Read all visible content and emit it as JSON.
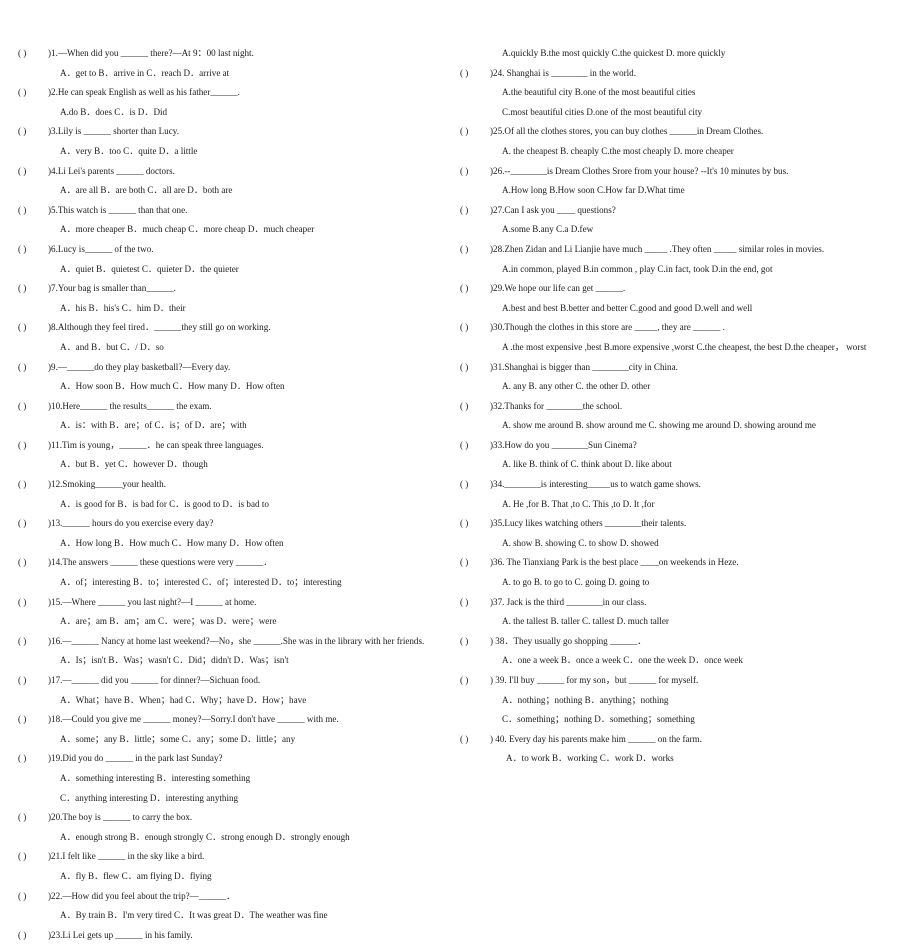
{
  "document": {
    "type": "english-grammar-multiple-choice-worksheet",
    "paren_marker": "(          )"
  },
  "left_column": [
    {
      "paren": "(",
      "stem": ")1.—When did you ______ there?—At 9：00 last night.",
      "options": [
        "A．get to                     B．arrive in      C．reach          D．arrive at"
      ]
    },
    {
      "paren": "(",
      "stem": ")2.He can speak English as well as his father______.",
      "options": [
        "A.do                          B．does            C．is                      D．Did"
      ]
    },
    {
      "paren": "(",
      "stem": ")3.Lily is ______ shorter than Lucy.",
      "options": [
        "A．very                      B．too              C．quite            D．a little"
      ]
    },
    {
      "paren": "(",
      "stem": ")4.Li Lei's parents ______ doctors.",
      "options": [
        "A．are all        B．are both        C．all are            D．both are"
      ]
    },
    {
      "paren": "(",
      "stem": ")5.This watch is ______ than that one.",
      "options": [
        "A．more cheaper        B．much cheap    C．more cheap        D．much cheaper"
      ]
    },
    {
      "paren": "(",
      "stem": ")6.Lucy is______ of the two.",
      "options": [
        "A．quiet            B．quietest      C．quieter        D．the quieter"
      ]
    },
    {
      "paren": "(",
      "stem": ")7.Your bag is smaller than______.",
      "options": [
        "A．his              B．his's      C．him      D．their"
      ]
    },
    {
      "paren": "(",
      "stem": ")8.Although they feel tired．______they still go on working.",
      "options": [
        "A．and            B．but          C．/        D．so"
      ]
    },
    {
      "paren": "(",
      "stem": ")9.—______do they play basketball?—Every day.",
      "options": [
        "A．How soon      B．How much    C．How many        D．How often"
      ]
    },
    {
      "paren": "(",
      "stem": ")10.Here______ the results______ the exam.",
      "options": [
        "A．is：with            B．are；of    C．is；of          D．are；with"
      ]
    },
    {
      "paren": "(",
      "stem": ")11.Tim is young，______．he can speak three languages.",
      "options": [
        "A．but          B．yet      C．however          D．though"
      ]
    },
    {
      "paren": "(",
      "stem": ")12.Smoking______your health.",
      "options": [
        "A．is good for    B．is bad for        C．is good to      D．is bad to"
      ]
    },
    {
      "paren": "(",
      "stem": ")13.______ hours do you exercise every day?",
      "options": [
        "A．How long      B．How much      C．How many        D．How often"
      ]
    },
    {
      "paren": "(",
      "stem": ")14.The answers ______ these questions were very ______．",
      "options": [
        "A．of；interesting            B．to；interested    C．of；interested            D．to；interesting"
      ]
    },
    {
      "paren": "(",
      "stem": ")15.—Where ______ you last night?—I ______ at home.",
      "options": [
        "A．are；am    B．am；am      C．were；was        D．were；were"
      ]
    },
    {
      "paren": "(",
      "stem": ")16.—______ Nancy at home last weekend?—No，she ______.She was in the library with her friends.",
      "options": [
        "A．Is；isn't        B．Was；wasn't        C．Did；didn't        D．Was；isn't"
      ]
    },
    {
      "paren": "(",
      "stem": ")17.—______ did you ______ for dinner?—Sichuan food.",
      "options": [
        "A．What；have        B．When；had      C．Why；have    D．How；have"
      ]
    },
    {
      "paren": "(",
      "stem": ")18.—Could you give me ______ money?—Sorry.I don't have ______ with me.",
      "options": [
        "A．some；any    B．little；some        C．any；some    D．little；any"
      ]
    },
    {
      "paren": "(",
      "stem": ")19.Did you do ______ in the park last Sunday?",
      "options": [
        "A．something interesting                  B．interesting something",
        "C．anything interesting                    D．interesting anything"
      ]
    },
    {
      "paren": "(",
      "stem": ")20.The boy is ______ to carry the box.",
      "options": [
        "A．enough strong        B．enough strongly    C．strong enough              D．strongly enough"
      ]
    },
    {
      "paren": "(",
      "stem": ")21.I felt like ______ in the sky like a bird.",
      "options": [
        "A．fly              B．flew      C．am flying        D．flying"
      ]
    },
    {
      "paren": "(",
      "stem": ")22.—How did you feel about the trip?—______．",
      "options": [
        "A．By train            B．I'm very tired      C．It was great      D．The weather was fine"
      ]
    },
    {
      "paren": "(",
      "stem": ")23.Li Lei gets up ______ in his family.",
      "options": []
    }
  ],
  "right_column": [
    {
      "paren": "",
      "stem": "",
      "lead_option": "A.quickly   B.the most quickly   C.the quickest   D. more quickly"
    },
    {
      "paren": "(",
      "stem": ")24. Shanghai is ________ in the world.",
      "options": [
        "A.the beautiful city    B.one of the most beautiful cities",
        "C.most beautiful cities    D.one of the most beautiful city"
      ]
    },
    {
      "paren": "(",
      "stem": ")25.Of all the clothes stores, you can buy clothes ______in Dream Clothes.",
      "options": [
        "A. the cheapest   B. cheaply   C.the most cheaply   D. more cheaper"
      ]
    },
    {
      "paren": "(",
      "stem": ")26.--________is Dream Clothes Srore from your house? --It's 10 minutes by bus.",
      "options": [
        "A.How long   B.How soon   C.How far   D.What time"
      ]
    },
    {
      "paren": "(",
      "stem": ")27.Can I ask you ____ questions?",
      "options": [
        "A.some   B.any   C.a   D.few"
      ]
    },
    {
      "paren": "(",
      "stem": ")28.Zhen Zidan and Li Lianjie have much _____ .They often _____ similar roles in movies.",
      "options": [
        "A.in common, played     B.in common , play     C.in fact, took        D.in the end, got"
      ]
    },
    {
      "paren": "(",
      "stem": ")29.We hope our life can get ______.",
      "options": [
        "A.best and best    B.better and better C.good and good D.well and well"
      ]
    },
    {
      "paren": "(",
      "stem": ")30.Though the clothes in this store are _____, they are ______ .",
      "options": [
        "A .the most expensive ,best    B.more expensive ,worst    C.the cheapest, the best      D.the cheaper，  worst"
      ]
    },
    {
      "paren": "(",
      "stem": ")31.Shanghai is bigger than ________city in China.",
      "options": [
        "A. any      B. any other      C. the other      D. other"
      ]
    },
    {
      "paren": "(",
      "stem": ")32.Thanks for ________the school.",
      "options": [
        "A. show me around     B. show around me     C. showing me around     D. showing around me"
      ]
    },
    {
      "paren": "(",
      "stem": ")33.How do you ________Sun Cinema?",
      "options": [
        "A. like      B. think of     C. think about     D. like about"
      ]
    },
    {
      "paren": "(",
      "stem": ")34.________is interesting_____us to watch game shows.",
      "options": [
        "A. He ,for     B. That ,to     C. This ,to     D. It ,for"
      ]
    },
    {
      "paren": "(",
      "stem": ")35.Lucy likes watching others ________their talents.",
      "options": [
        "A. show      B. showing      C. to show      D. showed"
      ]
    },
    {
      "paren": "(",
      "stem": ")36. The Tianxiang Park is the best place ____on weekends in Heze.",
      "options": [
        "A. to go     B. to go to     C. going     D. going to"
      ]
    },
    {
      "paren": "(",
      "stem": ")37. Jack is the third ________in our class.",
      "options": [
        "A. the tallest      B. taller      C. tallest     D. much taller"
      ]
    },
    {
      "paren": "(",
      "stem": ") 38．They usually go shopping ______．",
      "options": [
        "A．one a week                B．once a week    C．one the week                                  D．once week"
      ]
    },
    {
      "paren": "(",
      "stem": ") 39. I'll buy ______ for my son，but ______ for myself.",
      "options": [
        "A．nothing；nothing                          B．anything；nothing",
        "C．something；nothing                       D．something；something"
      ]
    },
    {
      "paren": "(",
      "stem": ") 40. Every day his parents make him ______ on the farm.",
      "options": [
        "A．to work    B．working     C．work      D．works"
      ]
    }
  ]
}
